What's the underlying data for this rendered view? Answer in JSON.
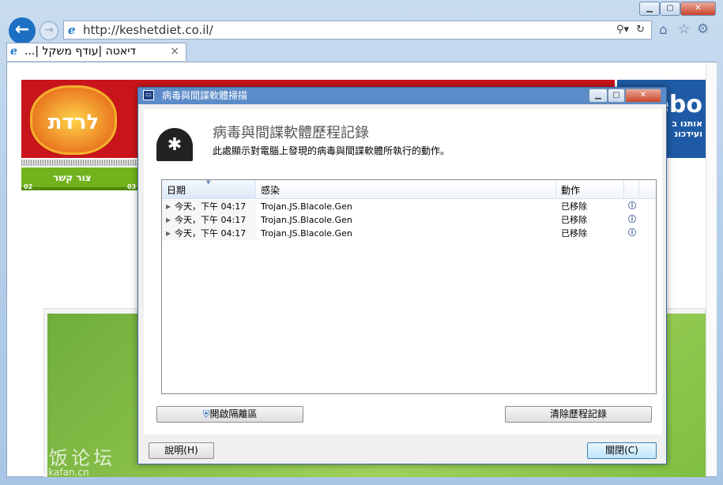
{
  "browser": {
    "url": "http://keshetdiet.co.il/",
    "tab_title": "דיאטה |עודף משקל |...",
    "window_controls": [
      "minimize",
      "maximize",
      "close"
    ],
    "icons": [
      "back-icon",
      "forward-icon",
      "search-icon",
      "refresh-icon",
      "home-icon",
      "favorites-star-icon",
      "gear-icon"
    ]
  },
  "page": {
    "nav_item": "צור קשר",
    "fb_text": "ebo",
    "fb_sub1": "אותנו ב",
    "fb_sub2": "ועידכונ",
    "nav_num1": "02",
    "nav_num2": "03"
  },
  "dialog": {
    "title": "病毒與間諜軟體掃描",
    "heading": "病毒與間諜軟體歷程記錄",
    "description": "此處顯示對電腦上發現的病毒與間諜軟體所執行的動作。",
    "table": {
      "columns": [
        "日期",
        "感染",
        "動作"
      ],
      "rows": [
        {
          "date": "今天，下午 04:17",
          "infection": "Trojan.JS.Blacole.Gen",
          "action": "已移除"
        },
        {
          "date": "今天，下午 04:17",
          "infection": "Trojan.JS.Blacole.Gen",
          "action": "已移除"
        },
        {
          "date": "今天，下午 04:17",
          "infection": "Trojan.JS.Blacole.Gen",
          "action": "已移除"
        }
      ]
    },
    "open_quarantine": "開啟隔離區",
    "clear_history": "清除歷程記錄",
    "help": "說明(H)",
    "close": "關閉(C)"
  },
  "watermark": {
    "text": "卡饭论坛",
    "url": "bbs.kafan.cn"
  }
}
